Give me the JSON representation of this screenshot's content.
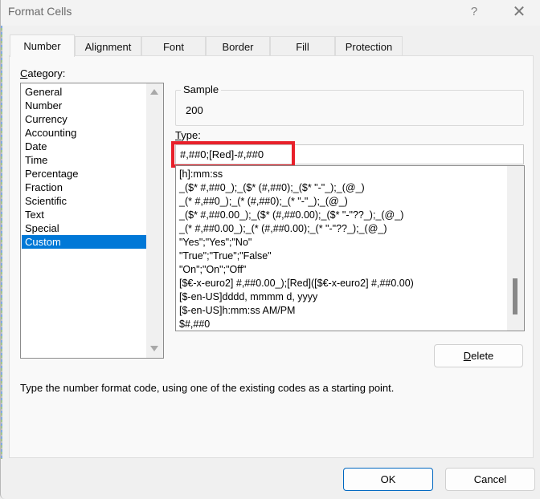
{
  "window": {
    "title": "Format Cells",
    "help_label": "?",
    "close_label": "✕"
  },
  "tabs": [
    {
      "label": "Number",
      "active": true
    },
    {
      "label": "Alignment",
      "active": false
    },
    {
      "label": "Font",
      "active": false
    },
    {
      "label": "Border",
      "active": false
    },
    {
      "label": "Fill",
      "active": false
    },
    {
      "label": "Protection",
      "active": false
    }
  ],
  "category": {
    "label_accel": "C",
    "label_rest": "ategory:",
    "items": [
      "General",
      "Number",
      "Currency",
      "Accounting",
      "Date",
      "Time",
      "Percentage",
      "Fraction",
      "Scientific",
      "Text",
      "Special",
      "Custom"
    ],
    "selected": "Custom"
  },
  "sample": {
    "legend": "Sample",
    "value": "200"
  },
  "type": {
    "label_accel": "T",
    "label_rest": "ype:",
    "value": "#,##0;[Red]-#,##0"
  },
  "format_list": {
    "items": [
      "[h]:mm:ss",
      "_($* #,##0_);_($* (#,##0);_($* \"-\"_);_(@_)",
      "_(* #,##0_);_(* (#,##0);_(* \"-\"_);_(@_)",
      "_($* #,##0.00_);_($* (#,##0.00);_($* \"-\"??_);_(@_)",
      "_(* #,##0.00_);_(* (#,##0.00);_(* \"-\"??_);_(@_)",
      "\"Yes\";\"Yes\";\"No\"",
      "\"True\";\"True\";\"False\"",
      "\"On\";\"On\";\"Off\"",
      "[$€-x-euro2] #,##0.00_);[Red]([$€-x-euro2] #,##0.00)",
      "[$-en-US]dddd, mmmm d, yyyy",
      "[$-en-US]h:mm:ss AM/PM",
      "$#,##0"
    ]
  },
  "buttons": {
    "delete_accel": "D",
    "delete_rest": "elete",
    "ok": "OK",
    "cancel": "Cancel"
  },
  "hint": "Type the number format code, using one of the existing codes as a starting point.",
  "colors": {
    "selection": "#0078d7",
    "highlight_box": "#e8202a",
    "primary_border": "#0067c0"
  }
}
